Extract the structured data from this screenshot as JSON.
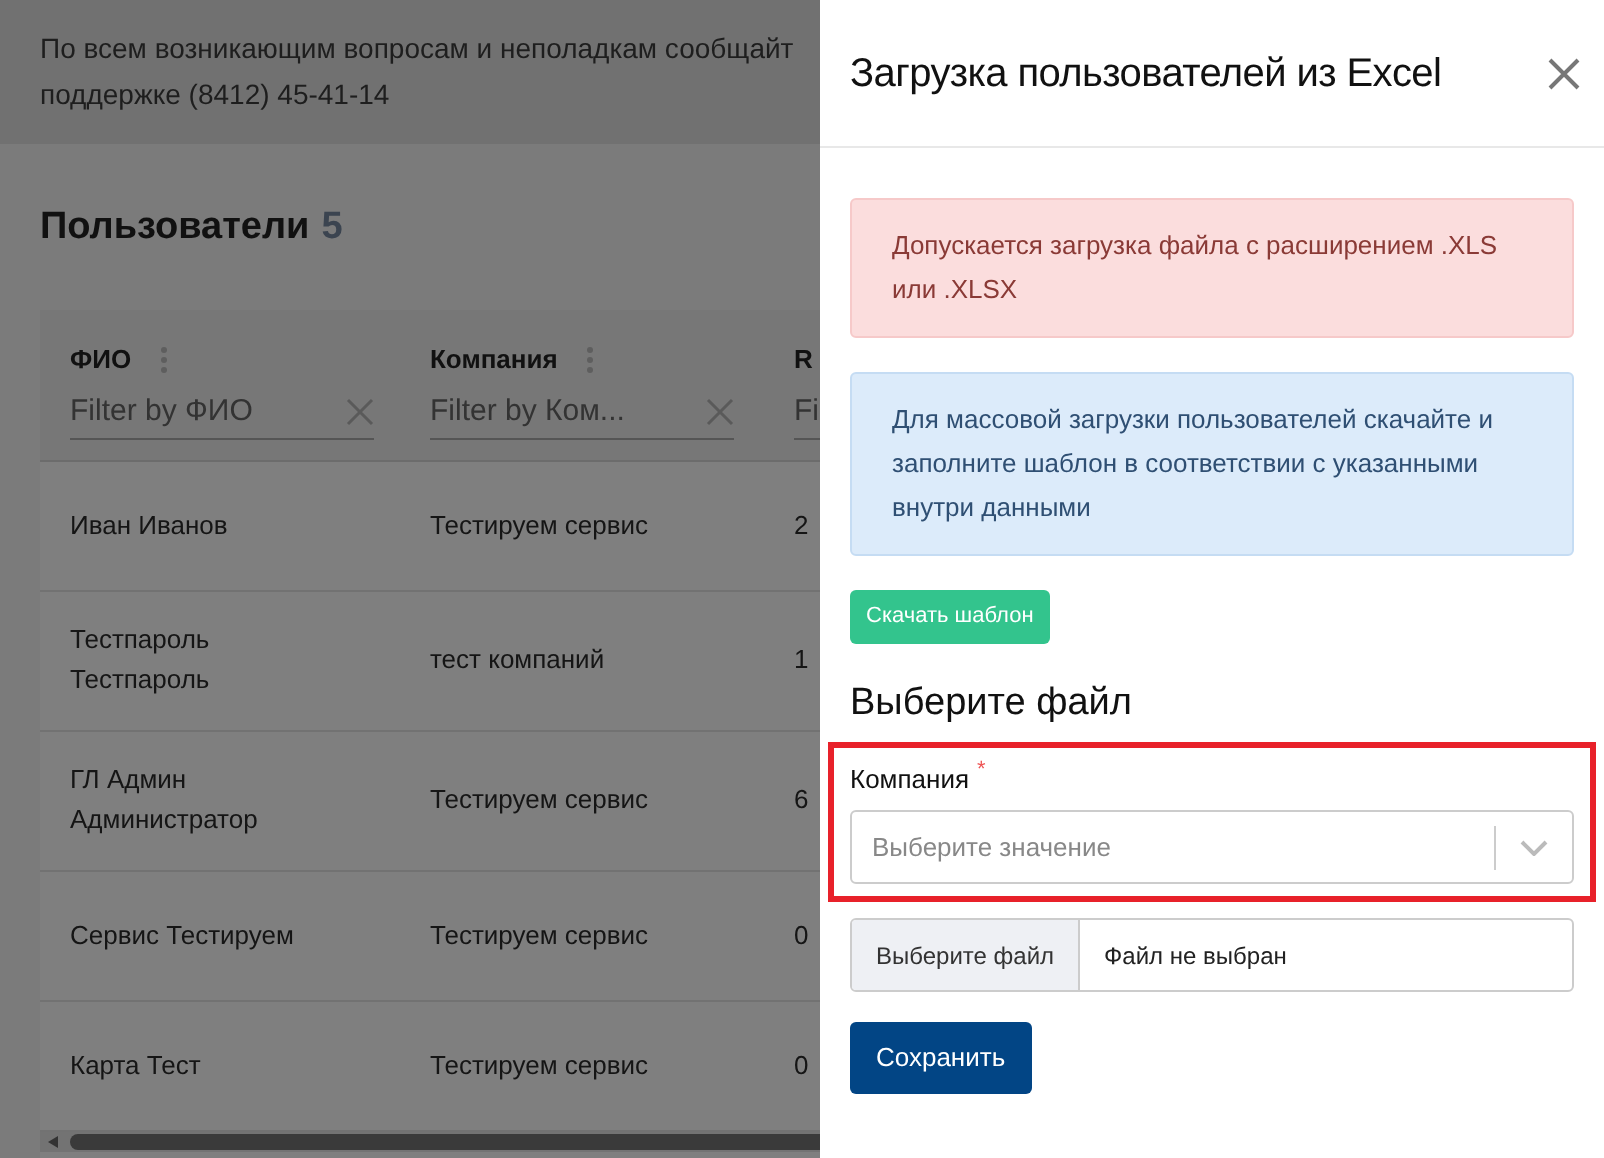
{
  "notice": {
    "lines": [
      "По всем возникающим вопросам и неполадкам сообщайт",
      "поддержке (8412) 45-41-14"
    ]
  },
  "page": {
    "title": "Пользователи",
    "count": "5"
  },
  "table": {
    "columns": [
      {
        "label": "ФИО",
        "filter_placeholder": "Filter by ФИО"
      },
      {
        "label": "Компания",
        "filter_placeholder": "Filter by Ком..."
      },
      {
        "label": "R",
        "filter_placeholder": "Fi"
      }
    ],
    "rows": [
      [
        "Иван Иванов",
        "Тестируем сервис",
        "2"
      ],
      [
        "Тестпароль Тестпароль",
        "тест компаний",
        "1"
      ],
      [
        "ГЛ Админ Администратор",
        "Тестируем сервис",
        "6"
      ],
      [
        "Сервис Тестируем",
        "Тестируем сервис",
        "0"
      ],
      [
        "Карта Тест",
        "Тестируем сервис",
        "0"
      ]
    ]
  },
  "drawer": {
    "title": "Загрузка пользователей из Excel",
    "alerts": [
      {
        "kind": "danger",
        "text": "Допускается загрузка файла с расширением .XLS или .XLSX"
      },
      {
        "kind": "info",
        "text": "Для массовой загрузки пользователей скачайте и заполните шаблон в соответствии с указанными внутри данными"
      }
    ],
    "download_button": "Скачать шаблон",
    "section_title": "Выберите файл",
    "company_field": {
      "label": "Компания",
      "required_mark": "*",
      "placeholder": "Выберите значение",
      "highlighted": true
    },
    "file_field": {
      "button": "Выберите файл",
      "status": "Файл не выбран"
    },
    "save_button": "Сохранить"
  }
}
